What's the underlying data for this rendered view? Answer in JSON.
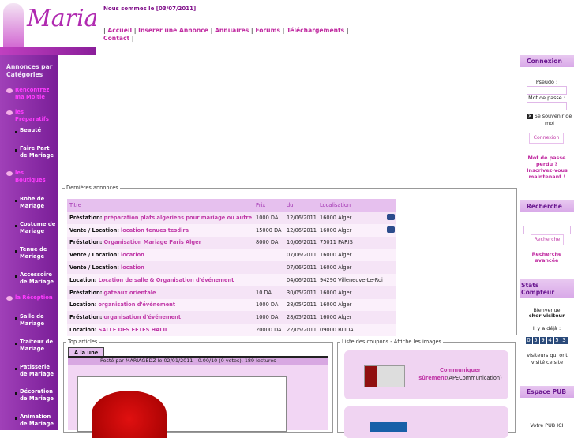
{
  "header": {
    "logo_text": "Mariage",
    "date_label": "Nous sommes le [03/07/2011]",
    "nav": [
      "Accueil",
      "Inserer une Annonce",
      "Annuaires",
      "Forums",
      "Téléchargements",
      "Contact"
    ]
  },
  "sidebar": {
    "title": "Annonces par Catégories",
    "items": [
      {
        "type": "cat",
        "label": "Rencontrez ma Moitie"
      },
      {
        "type": "cat",
        "label": "les Préparatifs"
      },
      {
        "type": "sub",
        "label": "Beauté"
      },
      {
        "type": "sub",
        "label": "Faire Part de Mariage"
      },
      {
        "type": "cat",
        "label": "les Boutiques"
      },
      {
        "type": "sub",
        "label": "Robe de Mariage"
      },
      {
        "type": "sub",
        "label": "Costume de Mariage"
      },
      {
        "type": "sub",
        "label": "Tenue de Mariage"
      },
      {
        "type": "sub",
        "label": "Accessoire de Mariage"
      },
      {
        "type": "cat",
        "label": "la Réception"
      },
      {
        "type": "sub",
        "label": "Salle de Mariage"
      },
      {
        "type": "sub",
        "label": "Traiteur de Mariage"
      },
      {
        "type": "sub",
        "label": "Patisserie de Mariage"
      },
      {
        "type": "sub",
        "label": "Décoration de Mariage"
      },
      {
        "type": "sub",
        "label": "Animation de Mariage"
      }
    ]
  },
  "annonces": {
    "legend": "Dernières annonces",
    "headers": [
      "Titre",
      "Prix",
      "du",
      "Localisation"
    ],
    "rows": [
      {
        "type": "Préstation:",
        "title": "préparation plats algeriens pour mariage ou autre",
        "price": "1000 DA",
        "date": "12/06/2011",
        "loc": "16000 Alger",
        "photo": true
      },
      {
        "type": "Vente / Location:",
        "title": "location tenues tesdira",
        "price": "15000 DA",
        "date": "12/06/2011",
        "loc": "16000 Alger",
        "photo": true
      },
      {
        "type": "Préstation:",
        "title": "Organisation Mariage Paris Alger",
        "price": "8000 DA",
        "date": "10/06/2011",
        "loc": "75011 PARIS",
        "photo": false
      },
      {
        "type": "Vente / Location:",
        "title": "location",
        "price": "",
        "date": "07/06/2011",
        "loc": "16000 Alger",
        "photo": false
      },
      {
        "type": "Vente / Location:",
        "title": "location",
        "price": "",
        "date": "07/06/2011",
        "loc": "16000 Alger",
        "photo": false
      },
      {
        "type": "Location:",
        "title": "Location de salle & Organisation d'événement",
        "price": "",
        "date": "04/06/2011",
        "loc": "94290 Villeneuve-Le-Roi",
        "photo": false
      },
      {
        "type": "Préstation:",
        "title": "gateaux orientale",
        "price": "10 DA",
        "date": "30/05/2011",
        "loc": "16000 Alger",
        "photo": false
      },
      {
        "type": "Location:",
        "title": "organisation d'événement",
        "price": "1000 DA",
        "date": "28/05/2011",
        "loc": "16000 Alger",
        "photo": false
      },
      {
        "type": "Préstation:",
        "title": "organisation d'événement",
        "price": "1000 DA",
        "date": "28/05/2011",
        "loc": "16000 Alger",
        "photo": false
      },
      {
        "type": "Location:",
        "title": "SALLE DES FETES HALIL",
        "price": "20000 DA",
        "date": "22/05/2011",
        "loc": "09000 BLIDA",
        "photo": false
      }
    ]
  },
  "top_articles": {
    "legend": "Top articles",
    "tab": "A la une",
    "posted": "Posté par MARIAGEDZ le 02/01/2011 - 0.00/10 (0 votes), 189 lectures"
  },
  "coupons": {
    "legend": "Liste des coupons - Affiche les images",
    "items": [
      {
        "link": "Communiquer sûrement",
        "company": "(APECommunication)"
      }
    ]
  },
  "right": {
    "login": {
      "title": "Connexion",
      "pseudo_label": "Pseudo :",
      "password_label": "Mot de passe :",
      "remember_label": "Se souvenir de moi",
      "button": "Connexion",
      "lost_password": "Mot de passe perdu ?",
      "register": "Inscrivez-vous maintenant !"
    },
    "search": {
      "title": "Recherche",
      "button": "Recherche",
      "advanced": "Recherche avancée"
    },
    "stats": {
      "title": "Stats Compteur",
      "welcome": "Bienvenue",
      "visitor": "cher visiteur",
      "already": "Il y a déjà :",
      "count": "059453",
      "suffix": "visiteurs qui ont visité ce site"
    },
    "pub": {
      "title": "Espace PUB",
      "text": "Votre PUB ICI"
    }
  }
}
